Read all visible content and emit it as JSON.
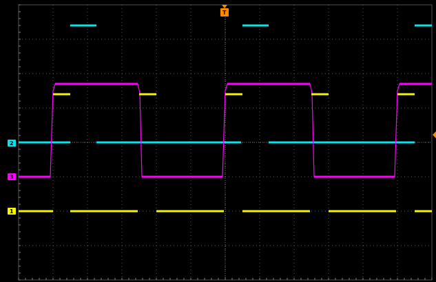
{
  "scope": {
    "channels": [
      {
        "id": "1",
        "label": "1",
        "color": "#f5f500"
      },
      {
        "id": "2",
        "label": "2",
        "color": "#00e5ee"
      },
      {
        "id": "3",
        "label": "3",
        "color": "#ff00ff"
      }
    ],
    "trigger": {
      "label": "T",
      "color": "#ff8a00"
    },
    "right_edge_marker_color": "#ff8a00"
  }
}
